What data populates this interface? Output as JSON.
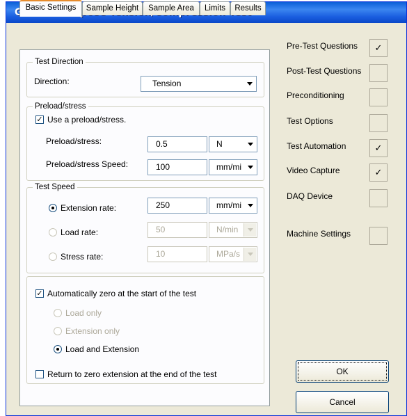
{
  "window": {
    "title": "General Purpose Tension/Compression Test"
  },
  "tabs": [
    {
      "label": "Basic Settings",
      "active": true
    },
    {
      "label": "Sample Height",
      "active": false
    },
    {
      "label": "Sample Area",
      "active": false
    },
    {
      "label": "Limits",
      "active": false
    },
    {
      "label": "Results",
      "active": false
    }
  ],
  "test_direction": {
    "legend": "Test Direction",
    "label": "Direction:",
    "value": "Tension"
  },
  "preload": {
    "legend": "Preload/stress",
    "use_label": "Use a preload/stress.",
    "use_checked": true,
    "value_label": "Preload/stress:",
    "value": "0.5",
    "value_unit": "N",
    "speed_label": "Preload/stress Speed:",
    "speed": "100",
    "speed_unit": "mm/mi"
  },
  "test_speed": {
    "legend": "Test Speed",
    "extension_label": "Extension rate:",
    "extension_value": "250",
    "extension_unit": "mm/mi",
    "load_label": "Load rate:",
    "load_value": "50",
    "load_unit": "N/min",
    "stress_label": "Stress rate:",
    "stress_value": "10",
    "stress_unit": "MPa/s",
    "selected": "extension"
  },
  "zero": {
    "auto_label": "Automatically zero at the start of the test",
    "auto_checked": true,
    "load_only": "Load only",
    "extension_only": "Extension only",
    "load_and_extension": "Load and Extension",
    "selected": "load_and_extension",
    "return_label": "Return to zero extension at the end of the test",
    "return_checked": false
  },
  "side_options": [
    {
      "label": "Pre-Test Questions",
      "checked": true
    },
    {
      "label": "Post-Test Questions",
      "checked": false
    },
    {
      "label": "Preconditioning",
      "checked": false
    },
    {
      "label": "Test Options",
      "checked": false
    },
    {
      "label": "Test Automation",
      "checked": true
    },
    {
      "label": "Video Capture",
      "checked": true
    },
    {
      "label": "DAQ Device",
      "checked": false
    },
    {
      "label": "Machine Settings",
      "checked": false
    }
  ],
  "check_mark": "✓",
  "buttons": {
    "ok": "OK",
    "cancel": "Cancel"
  },
  "colors": {
    "title_bar": "#0a5fd8",
    "dialog_bg": "#ece9d8",
    "panel_bg": "#fcfcfe",
    "active_tab_accent": "#e68b2c"
  }
}
